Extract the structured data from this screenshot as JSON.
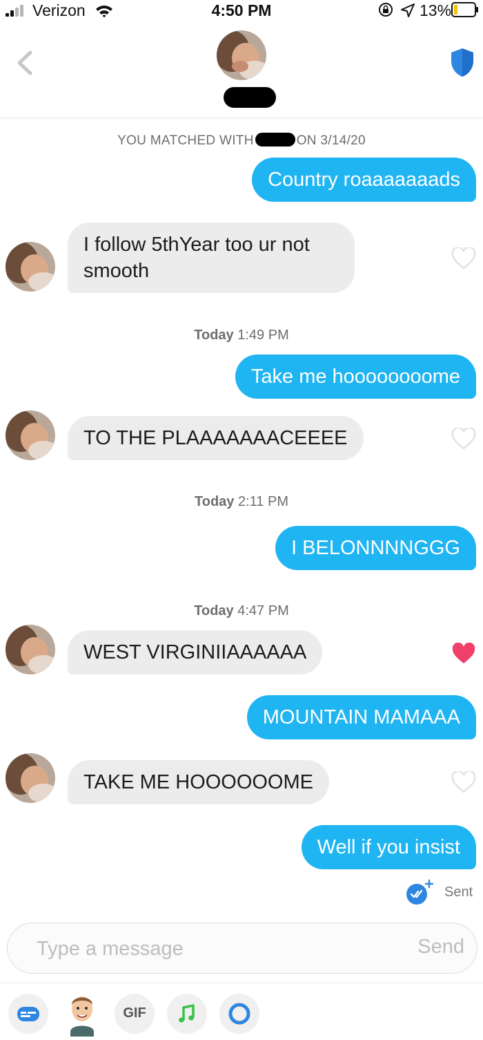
{
  "status_bar": {
    "carrier": "Verizon",
    "time": "4:50 PM",
    "battery": "13%"
  },
  "header": {
    "back_icon": "chevron-left-icon",
    "safety_icon": "shield-icon"
  },
  "conversation": {
    "matched_prefix": "YOU MATCHED WITH",
    "matched_suffix": "ON 3/14/20",
    "messages": [
      {
        "side": "out",
        "text": "Country roaaaaaaads"
      },
      {
        "side": "in",
        "text": "I follow 5thYear too ur not smooth",
        "liked": false
      },
      {
        "side": "stamp",
        "day": "Today",
        "time": "1:49 PM"
      },
      {
        "side": "out",
        "text": "Take me hoooooooome"
      },
      {
        "side": "in",
        "text": "TO THE PLAAAAAAACEEEE",
        "liked": false
      },
      {
        "side": "stamp",
        "day": "Today",
        "time": "2:11 PM"
      },
      {
        "side": "out",
        "text": "I BELONNNNGGG"
      },
      {
        "side": "stamp",
        "day": "Today",
        "time": "4:47 PM"
      },
      {
        "side": "in",
        "text": "WEST VIRGINIIAAAAAA",
        "liked": true
      },
      {
        "side": "out",
        "text": "MOUNTAIN MAMAAA"
      },
      {
        "side": "in",
        "text": "TAKE ME HOOOOOOME",
        "liked": false
      },
      {
        "side": "out",
        "text": "Well if you insist"
      }
    ],
    "sent_status": "Sent"
  },
  "composer": {
    "placeholder": "Type a message",
    "send_label": "Send"
  },
  "toolbar": {
    "gif_label": "GIF",
    "items": [
      "tinder-card-icon",
      "bitmoji-icon",
      "gif-icon",
      "music-note-icon",
      "loop-icon"
    ]
  },
  "colors": {
    "outgoing_bubble": "#1fb4f2",
    "incoming_bubble": "#ececec",
    "like_heart": "#f0406a",
    "shield": "#2f86e0"
  }
}
